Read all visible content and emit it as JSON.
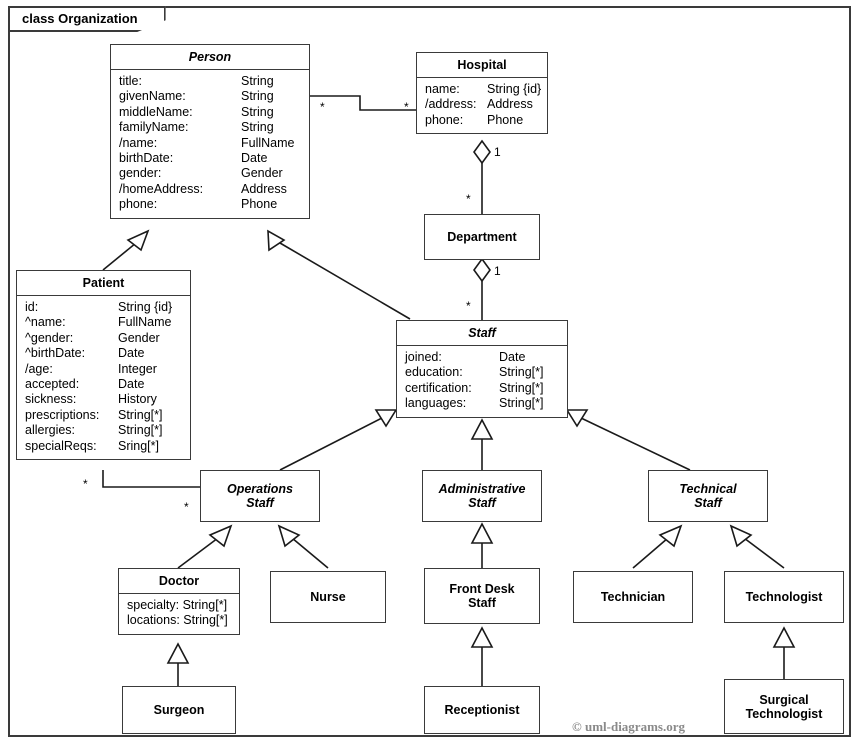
{
  "frame": {
    "label": "class Organization"
  },
  "copyright": "© uml-diagrams.org",
  "classes": {
    "person": {
      "name": "Person",
      "attrs": [
        {
          "n": "title:",
          "t": "String"
        },
        {
          "n": "givenName:",
          "t": "String"
        },
        {
          "n": "middleName:",
          "t": "String"
        },
        {
          "n": "familyName:",
          "t": "String"
        },
        {
          "n": "/name:",
          "t": "FullName"
        },
        {
          "n": "birthDate:",
          "t": "Date"
        },
        {
          "n": "gender:",
          "t": "Gender"
        },
        {
          "n": "/homeAddress:",
          "t": "Address"
        },
        {
          "n": "phone:",
          "t": "Phone"
        }
      ]
    },
    "hospital": {
      "name": "Hospital",
      "attrs": [
        {
          "n": "name:",
          "t": "String {id}"
        },
        {
          "n": "/address:",
          "t": "Address"
        },
        {
          "n": "phone:",
          "t": "Phone"
        }
      ]
    },
    "department": {
      "name": "Department"
    },
    "patient": {
      "name": "Patient",
      "attrs": [
        {
          "n": "id:",
          "t": "String {id}"
        },
        {
          "n": "^name:",
          "t": "FullName"
        },
        {
          "n": "^gender:",
          "t": "Gender"
        },
        {
          "n": "^birthDate:",
          "t": "Date"
        },
        {
          "n": "/age:",
          "t": "Integer"
        },
        {
          "n": "accepted:",
          "t": "Date"
        },
        {
          "n": "sickness:",
          "t": "History"
        },
        {
          "n": "prescriptions:",
          "t": "String[*]"
        },
        {
          "n": "allergies:",
          "t": "String[*]"
        },
        {
          "n": "specialReqs:",
          "t": "Sring[*]"
        }
      ]
    },
    "staff": {
      "name": "Staff",
      "attrs": [
        {
          "n": "joined:",
          "t": "Date"
        },
        {
          "n": "education:",
          "t": "String[*]"
        },
        {
          "n": "certification:",
          "t": "String[*]"
        },
        {
          "n": "languages:",
          "t": "String[*]"
        }
      ]
    },
    "operations_staff": {
      "name": "Operations\nStaff"
    },
    "administrative_staff": {
      "name": "Administrative\nStaff"
    },
    "technical_staff": {
      "name": "Technical\nStaff"
    },
    "doctor": {
      "name": "Doctor",
      "attrs": [
        {
          "n": "specialty: String[*]",
          "t": ""
        },
        {
          "n": "locations: String[*]",
          "t": ""
        }
      ]
    },
    "nurse": {
      "name": "Nurse"
    },
    "front_desk_staff": {
      "name": "Front Desk\nStaff"
    },
    "technician": {
      "name": "Technician"
    },
    "technologist": {
      "name": "Technologist"
    },
    "surgeon": {
      "name": "Surgeon"
    },
    "receptionist": {
      "name": "Receptionist"
    },
    "surgical_technologist": {
      "name": "Surgical\nTechnologist"
    }
  },
  "multiplicities": {
    "person_hospital_src": "*",
    "person_hospital_tgt": "*",
    "hospital_department_one": "1",
    "hospital_department_many": "*",
    "department_staff_one": "1",
    "department_staff_many": "*",
    "patient_ops_src": "*",
    "patient_ops_tgt": "*"
  }
}
